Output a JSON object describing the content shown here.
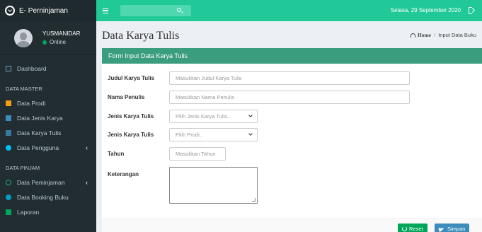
{
  "app": {
    "brand": "E- Perninjaman"
  },
  "user": {
    "name": "YUSMANIDAR",
    "status": "Online"
  },
  "topbar": {
    "date": "Selasa, 29 September 2020"
  },
  "sidebar": {
    "items": [
      {
        "label": "Dashboard",
        "icon": "monitor-icon"
      },
      {
        "header": "DATA MASTER"
      },
      {
        "label": "Data Prodi",
        "icon": "book-icon"
      },
      {
        "label": "Data Jenis Karya",
        "icon": "edit-icon"
      },
      {
        "label": "Data Karya Tulis",
        "icon": "book-icon"
      },
      {
        "label": "Data Pengguna",
        "icon": "users-icon",
        "caret": "‹"
      },
      {
        "header": "DATA PINJAM"
      },
      {
        "label": "Data Peminjaman",
        "icon": "loop-icon",
        "caret": "‹"
      },
      {
        "label": "Data Booking Buku",
        "icon": "circle-icon"
      },
      {
        "label": "Laporan",
        "icon": "file-icon"
      }
    ]
  },
  "page": {
    "title": "Data Karya Tulis",
    "breadcrumb": {
      "home": "Home",
      "sep": "/",
      "current": "Input Data Buku"
    }
  },
  "form": {
    "header": "Form Input Data Karya Tulis",
    "fields": {
      "judul": {
        "label": "Judul Karya Tulis",
        "placeholder": "Masukkan Judul Karya Tulis"
      },
      "nama": {
        "label": "Nama Penulis",
        "placeholder": "Masukkan Nama Penulis"
      },
      "jenis": {
        "label": "Jenis Karya Tulis",
        "selected": "Pilih Jenis Karya Tulis.."
      },
      "prodi": {
        "label": "Jenis Karya Tulis",
        "selected": "Pilih Prodi.."
      },
      "tahun": {
        "label": "Tahun",
        "placeholder": "Masukkan Tahun"
      },
      "keterangan": {
        "label": "Keterangan",
        "value": ""
      }
    },
    "buttons": {
      "reset": "Reset",
      "save": "Simpan"
    }
  }
}
